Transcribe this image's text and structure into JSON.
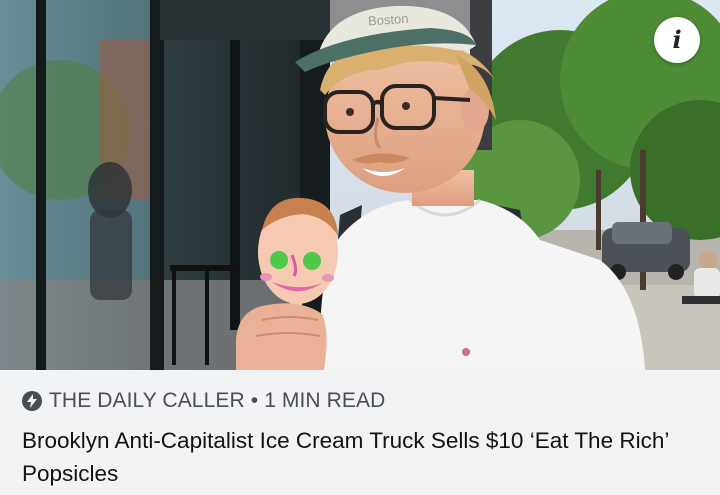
{
  "article": {
    "source_name": "THE DAILY CALLER",
    "separator": "•",
    "read_time": "1 MIN READ",
    "headline": "Brooklyn Anti-Capitalist Ice Cream Truck Sells $10 ‘Eat The Rich’ Popsicles"
  },
  "overlay": {
    "info_label": "i"
  },
  "icons": {
    "source": "lightning-bolt-icon",
    "info": "info-icon"
  },
  "colors": {
    "meta_text": "#4a4d52",
    "headline_text": "#111214",
    "caption_bg": "#f2f3f5"
  }
}
